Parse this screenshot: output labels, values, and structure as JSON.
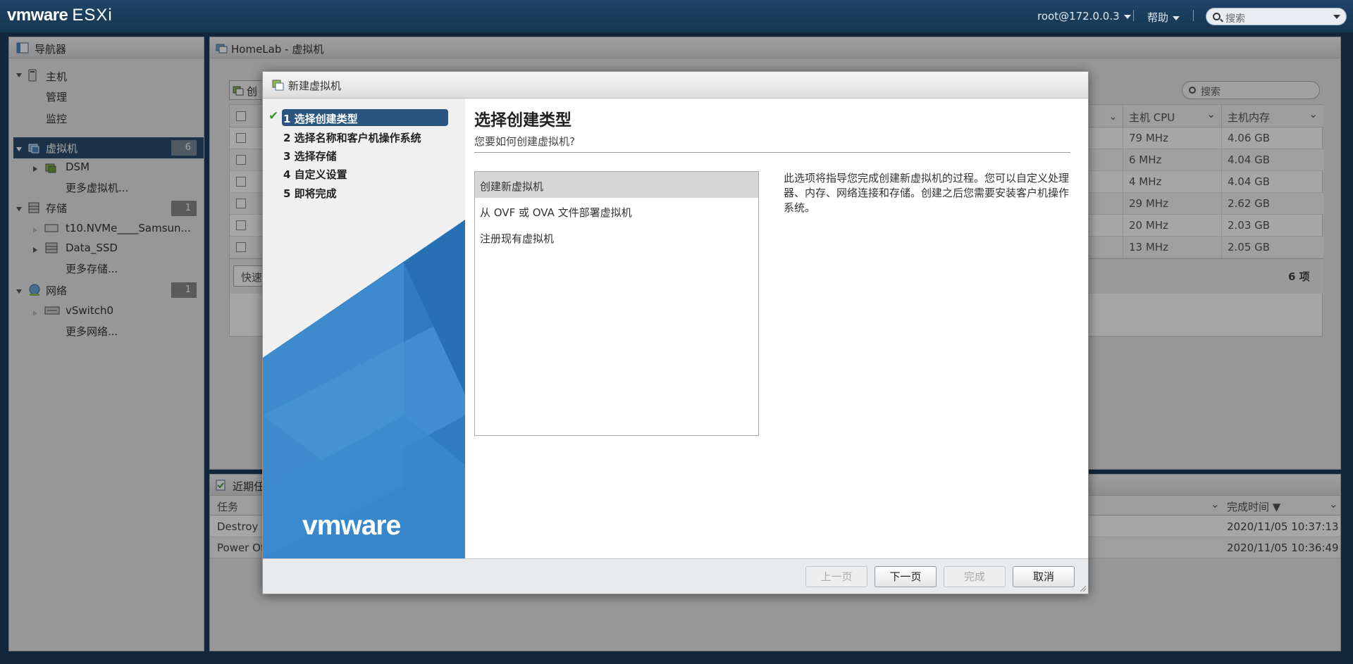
{
  "topbar": {
    "logo_vm": "vmware",
    "logo_product": "ESXi",
    "user": "root@172.0.0.3",
    "help": "帮助",
    "search_placeholder": "搜索"
  },
  "navigator": {
    "title": "导航器",
    "host": "主机",
    "manage": "管理",
    "monitor": "监控",
    "vms": "虚拟机",
    "vms_count": "6",
    "vm_dsm": "DSM",
    "more_vms": "更多虚拟机...",
    "storage": "存储",
    "storage_count": "1",
    "ds_nvme": "t10.NVMe____Samsun...",
    "ds_ssd": "Data_SSD",
    "more_storage": "更多存储...",
    "network": "网络",
    "network_count": "1",
    "vswitch": "vSwitch0",
    "more_network": "更多网络..."
  },
  "main": {
    "title": "HomeLab - 虚拟机",
    "create_btn_partial": "创",
    "quick_filter_partial": "快速",
    "search_placeholder": "搜索",
    "col_cpu": "主机 CPU",
    "col_mem": "主机内存",
    "rows": [
      {
        "cpu": "79 MHz",
        "mem": "4.06 GB"
      },
      {
        "cpu": "6 MHz",
        "mem": "4.04 GB"
      },
      {
        "cpu": "4 MHz",
        "mem": "4.04 GB"
      },
      {
        "cpu": "29 MHz",
        "mem": "2.62 GB"
      },
      {
        "cpu": "20 MHz",
        "mem": "2.03 GB"
      },
      {
        "cpu": "13 MHz",
        "mem": "2.05 GB"
      }
    ],
    "item_count": "6 项"
  },
  "tasks": {
    "title_partial": "近期任",
    "col_task": "任务",
    "col_done": "完成时间 ▼",
    "rows": [
      {
        "task": "Destroy",
        "time": "2020/11/05 10:37:13"
      },
      {
        "task": "Power Of",
        "time": "2020/11/05 10:36:49"
      }
    ]
  },
  "dialog": {
    "title": "新建虚拟机",
    "steps": [
      "1 选择创建类型",
      "2 选择名称和客户机操作系统",
      "3 选择存储",
      "4 自定义设置",
      "5 即将完成"
    ],
    "brand": "vmware",
    "heading": "选择创建类型",
    "subheading": "您要如何创建虚拟机?",
    "options": [
      "创建新虚拟机",
      "从 OVF 或 OVA 文件部署虚拟机",
      "注册现有虚拟机"
    ],
    "description": "此选项将指导您完成创建新虚拟机的过程。您可以自定义处理器、内存、网络连接和存储。创建之后您需要安装客户机操作系统。",
    "buttons": {
      "back": "上一页",
      "next": "下一页",
      "finish": "完成",
      "cancel": "取消"
    }
  },
  "colors": {
    "topbar": "#1c3d5d",
    "nav_selected": "#2a4d6f",
    "step_active": "#2c5682",
    "brand_blue": "#2f7cc1"
  }
}
